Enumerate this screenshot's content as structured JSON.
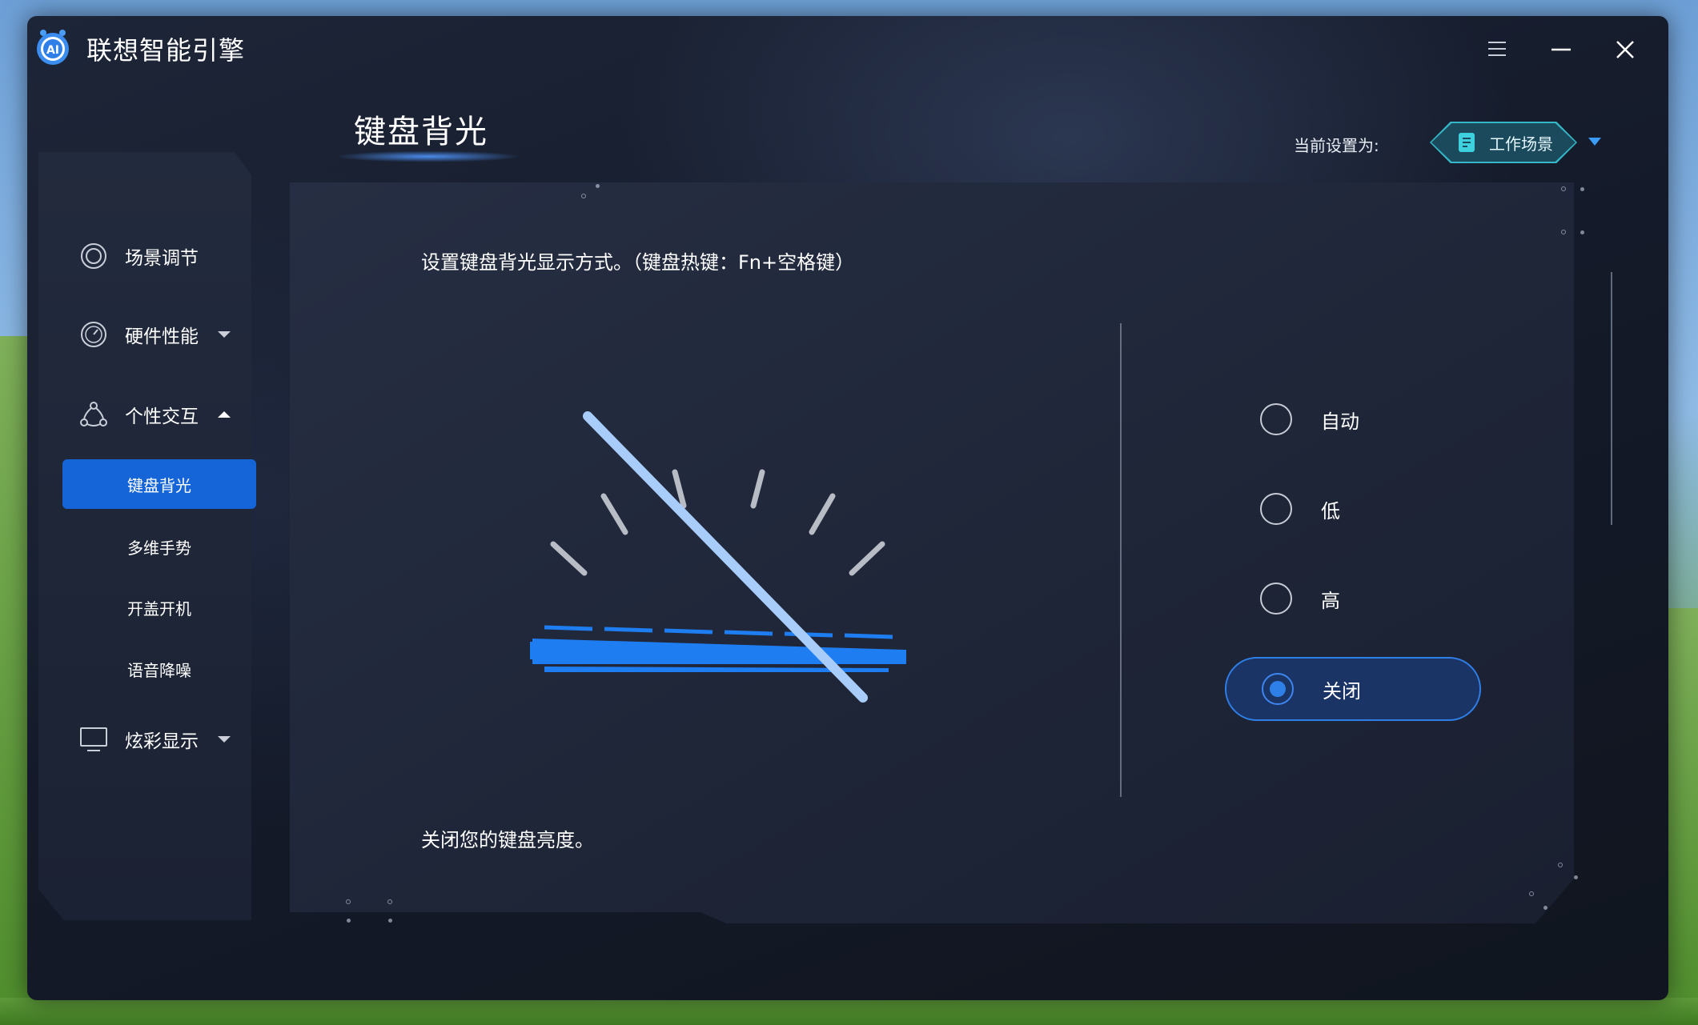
{
  "app": {
    "title": "联想智能引擎",
    "logo_text": "AI"
  },
  "window_controls": {
    "menu": "menu-icon",
    "minimize": "minimize-icon",
    "close": "close-icon"
  },
  "page": {
    "title": "键盘背光",
    "current_setting_label": "当前设置为:",
    "current_scene": "工作场景"
  },
  "sidebar": {
    "items": [
      {
        "label": "场景调节",
        "icon": "target-icon"
      },
      {
        "label": "硬件性能",
        "icon": "gauge-icon",
        "expanded": false
      },
      {
        "label": "个性交互",
        "icon": "interaction-icon",
        "expanded": true
      },
      {
        "label": "炫彩显示",
        "icon": "monitor-icon",
        "expanded": false
      }
    ],
    "subitems": [
      {
        "label": "键盘背光",
        "active": true
      },
      {
        "label": "多维手势",
        "active": false
      },
      {
        "label": "开盖开机",
        "active": false
      },
      {
        "label": "语音降噪",
        "active": false
      }
    ]
  },
  "main": {
    "description": "设置键盘背光显示方式。（键盘热键：Fn+空格键）",
    "footer_text": "关闭您的键盘亮度。",
    "options": [
      {
        "label": "自动",
        "selected": false
      },
      {
        "label": "低",
        "selected": false
      },
      {
        "label": "高",
        "selected": false
      },
      {
        "label": "关闭",
        "selected": true
      }
    ]
  },
  "colors": {
    "accent": "#1565d8",
    "keyboard_blue": "#1e7df0",
    "slash": "#a9cdfb"
  }
}
